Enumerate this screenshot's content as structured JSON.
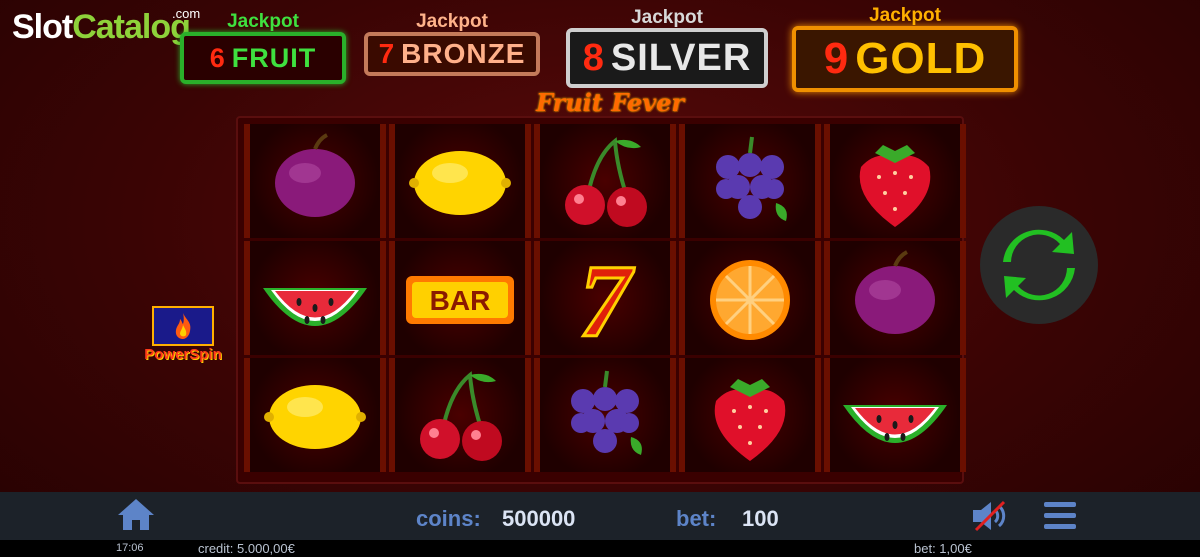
{
  "watermark": {
    "part1": "Slot",
    "part2": "Catalog",
    "suffix": ".com"
  },
  "jackpots": [
    {
      "label": "Jackpot",
      "number": "6",
      "name": "FRUIT"
    },
    {
      "label": "Jackpot",
      "number": "7",
      "name": "BRONZE"
    },
    {
      "label": "Jackpot",
      "number": "8",
      "name": "SILVER"
    },
    {
      "label": "Jackpot",
      "number": "9",
      "name": "GOLD"
    }
  ],
  "game_title": "Fruit Fever",
  "reels": [
    [
      "plum",
      "lemon",
      "cherries",
      "grapes",
      "strawberry"
    ],
    [
      "watermelon",
      "bar",
      "seven",
      "orange",
      "plum"
    ],
    [
      "lemon",
      "cherries",
      "grapes",
      "strawberry",
      "watermelon"
    ]
  ],
  "bar_symbol_text": "BAR",
  "seven_symbol_text": "7",
  "powerspin_label": "PowerSpin",
  "spin_icon": "refresh-icon",
  "bottom_bar": {
    "coins_label": "coins:",
    "coins_value": "500000",
    "bet_label": "bet:",
    "bet_value": "100"
  },
  "status_bar": {
    "time": "17:06",
    "credit": "credit: 5.000,00€",
    "bet": "bet: 1,00€"
  },
  "colors": {
    "background": "#3a0404",
    "accent_blue": "#5d84c8",
    "spin_green": "#22c022",
    "jackpot_gold": "#ffc000"
  }
}
